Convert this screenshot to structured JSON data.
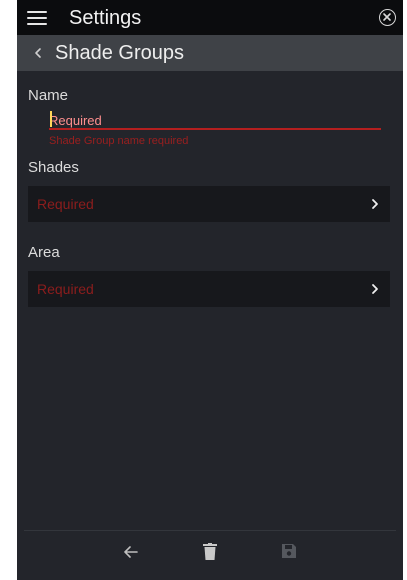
{
  "header": {
    "title": "Settings",
    "menu_icon": "hamburger-menu-icon",
    "close_icon": "close-circle-icon"
  },
  "subheader": {
    "title": "Shade Groups",
    "back_icon": "chevron-left-icon"
  },
  "form": {
    "name": {
      "label": "Name",
      "placeholder": "Required",
      "value": "",
      "error": "Shade Group name required"
    },
    "shades": {
      "label": "Shades",
      "value": "Required",
      "chevron_icon": "chevron-right-icon"
    },
    "area": {
      "label": "Area",
      "value": "Required",
      "chevron_icon": "chevron-right-icon"
    }
  },
  "bottom_bar": {
    "back_icon": "arrow-left-icon",
    "delete_icon": "trash-icon",
    "save_icon": "save-disk-icon"
  },
  "colors": {
    "background": "#23252b",
    "topbar": "#0b0c0e",
    "subbar": "#3f4247",
    "error": "#b41f1f",
    "required_text": "#8c1d1d",
    "row_background": "#17181c"
  }
}
